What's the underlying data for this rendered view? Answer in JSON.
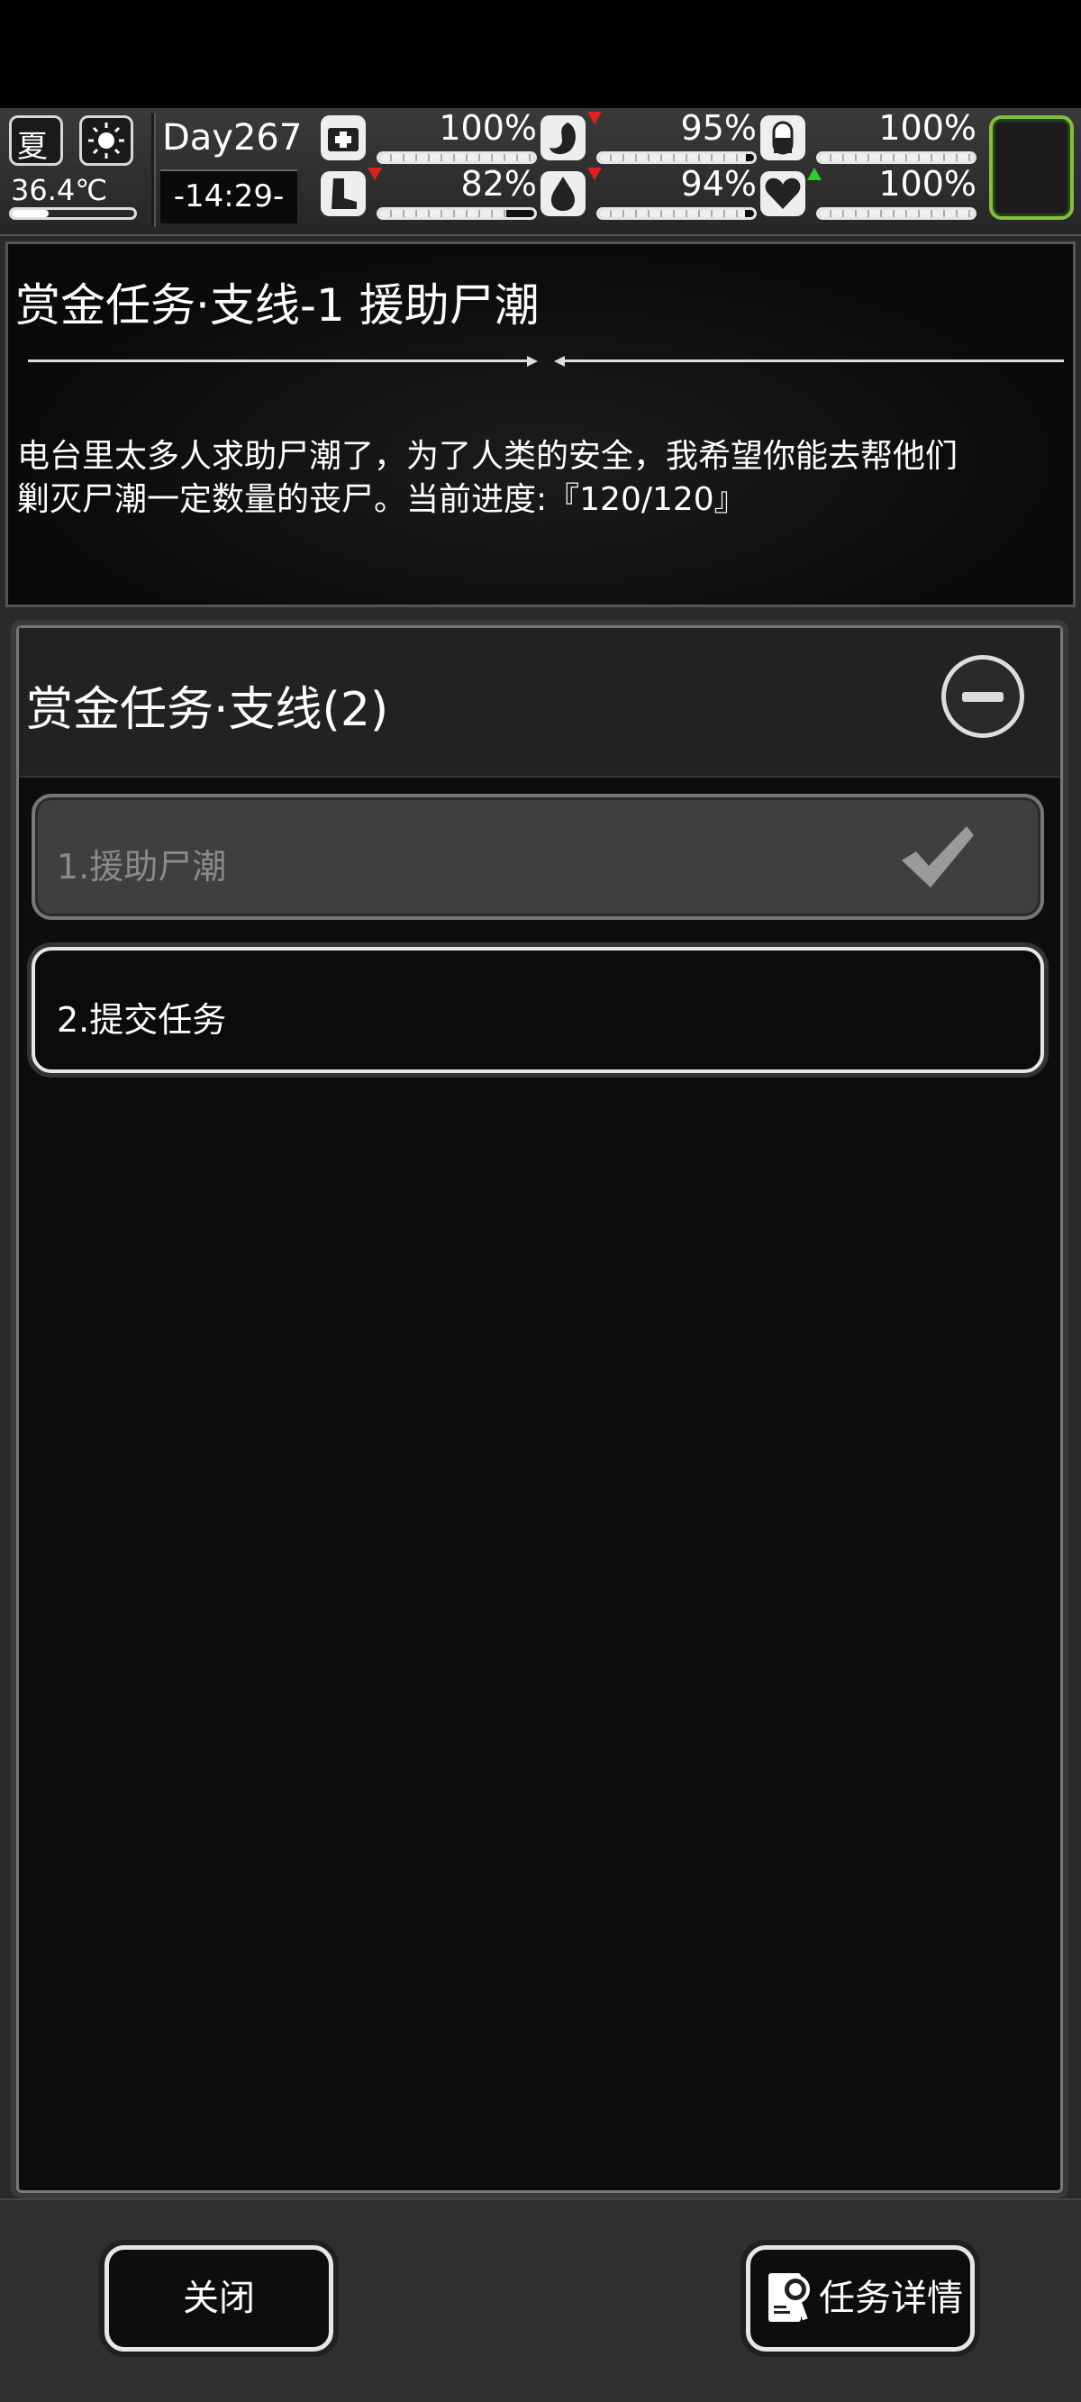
{
  "status": {
    "season": "夏",
    "temperature": "36.4℃",
    "day": "Day267",
    "time": "-14:29-",
    "stats": [
      {
        "name": "health",
        "icon": "medkit-icon",
        "value": "100%",
        "level": 1.0,
        "trend": ""
      },
      {
        "name": "hunger",
        "icon": "stomach-icon",
        "value": "95%",
        "level": 0.95,
        "trend": "down"
      },
      {
        "name": "medicine",
        "icon": "pill-icon",
        "value": "100%",
        "level": 1.0,
        "trend": ""
      },
      {
        "name": "stamina",
        "icon": "boot-icon",
        "value": "82%",
        "level": 0.82,
        "trend": "down"
      },
      {
        "name": "thirst",
        "icon": "water-drop-icon",
        "value": "94%",
        "level": 0.94,
        "trend": "down"
      },
      {
        "name": "mood",
        "icon": "heart-icon",
        "value": "100%",
        "level": 1.0,
        "trend": "up"
      }
    ]
  },
  "quest": {
    "title": "赏金任务·支线-1 援助尸潮",
    "description_line1": "电台里太多人求助尸潮了，为了人类的安全，我希望你能去帮他们",
    "description_line2": "剿灭尸潮一定数量的丧尸。当前进度:『120/120』"
  },
  "list": {
    "title": "赏金任务·支线(2)",
    "items": [
      {
        "label": "1.援助尸潮",
        "completed": true
      },
      {
        "label": "2.提交任务",
        "completed": false
      }
    ]
  },
  "buttons": {
    "close": "关闭",
    "details": "任务详情"
  }
}
